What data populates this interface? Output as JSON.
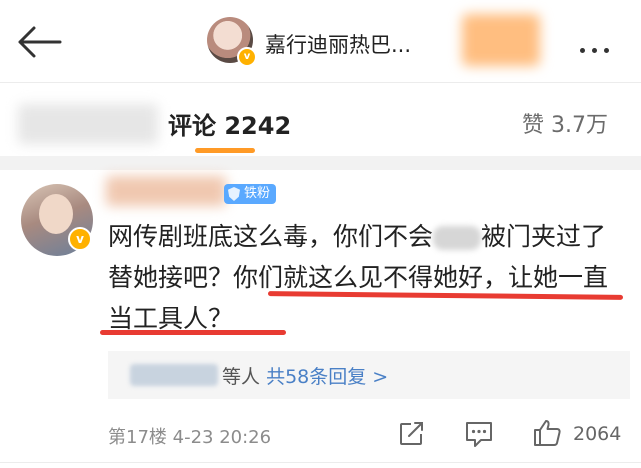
{
  "header": {
    "title": "嘉行迪丽热巴...",
    "back_icon": "back-arrow-icon",
    "more_icon": "more-dots-icon"
  },
  "tabs": {
    "comments_label": "评论 2242",
    "likes_label": "赞 3.7万",
    "accent_color": "#ff9a26"
  },
  "comment": {
    "tag_label": "铁粉",
    "text_part1": "网传剧班底这么毒，你们不会",
    "text_part2": "被门夹过了替她接吧？你们就这么见不得她好，让她一直当工具人？",
    "replies_suffix": "等人",
    "replies_link": "共58条回复 >",
    "floor": "第17楼",
    "time": "4-23 20:26",
    "like_count": "2064",
    "underline_color": "#e83b32"
  }
}
